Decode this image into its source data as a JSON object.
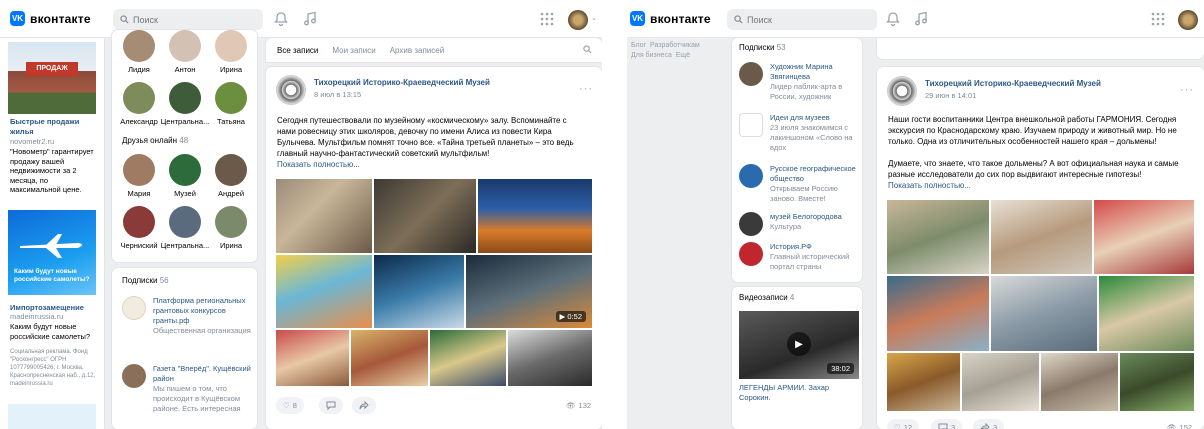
{
  "brand": "вконтакте",
  "search_placeholder": "Поиск",
  "left": {
    "friends_top": [
      "Лидия",
      "Антон",
      "Ирина",
      "Александр",
      "Центральна...",
      "Татьяна"
    ],
    "friends_online_label": "Друзья онлайн",
    "friends_online_count": "48",
    "friends_online": [
      "Мария",
      "Музей",
      "Андрей",
      "Черниский",
      "Центральна...",
      "Ирина"
    ],
    "ads": [
      {
        "title": "Быстрые продажи жилья",
        "source": "novometr2.ru",
        "text": "\"Новометр\" гарантирует продажу вашей недвижимости за 2 месяца, по максимальной цене."
      },
      {
        "title": "Импортозамещение",
        "source": "madeinrussia.ru",
        "text": "Каким будут новые российские самолеты?",
        "legal": "Социальная реклама. Фонд \"Росконгресс\" ОГРН 1077799005426, г. Москва, Краснопресненская наб., д.12, madeinrussia.ru",
        "banner_text": "Каким будут новые российские самолеты?"
      }
    ],
    "subs_label": "Подписки",
    "subs_count": "56",
    "subs": [
      {
        "name": "Платформа региональных грантовых конкурсов гранты.рф",
        "desc": "Общественная организация"
      },
      {
        "name": "Газета \"Вперёд\". Кущёвский район",
        "desc": "Мы пишем о том, что происходит в Кущёвском районе. Есть интересная"
      }
    ],
    "tabs": [
      "Все записи",
      "Мои записи",
      "Архив записей"
    ],
    "post": {
      "author": "Тихорецкий Историко-Краеведческий Музей",
      "date": "8 июл в 13:15",
      "text": "Сегодня путешествовали по музейному «космическому» залу. Вспоминайте с нами ровесницу этих школяров, девочку по имени Алиса из повести Кира Булычева. Мультфильм помнят точно все. «Тайна третьей планеты» – это ведь главный научно-фантастический советский мультфильм!",
      "more": "Показать полностью...",
      "video_duration": "0:52",
      "likes": "8",
      "views": "132"
    }
  },
  "right": {
    "side_links": [
      "Блог",
      "Разработчикам",
      "Для бизнеса",
      "Ещё"
    ],
    "subs_label": "Подписки",
    "subs_count": "53",
    "subs": [
      {
        "name": "Художник Марина Звягинцева",
        "desc": "Лидер паблик-арта в России, художник"
      },
      {
        "name": "Идеи для музеев",
        "desc": "23 июля знакомимся с лакиншоном «Слово на вдох"
      },
      {
        "name": "Русское географическое общество",
        "desc": "Открываем Россию заново. Вместе!"
      },
      {
        "name": "музей Белогородова",
        "desc": "Культура"
      },
      {
        "name": "История.РФ",
        "desc": "Главный исторический портал страны"
      }
    ],
    "videos_label": "Видеозаписи",
    "videos_count": "4",
    "video": {
      "duration": "38:02",
      "title": "ЛЕГЕНДЫ АРМИИ. Захар Сорокин."
    },
    "post": {
      "author": "Тихорецкий Историко-Краеведческий Музей",
      "date": "29 июн в 14:01",
      "text1": "Наши гости воспитанники Центра внешкольной работы ГАРМОНИЯ. Сегодня экскурсия по Краснодарскому краю. Изучаем природу и животный мир. Но не только. Одна из отличительных особенностей нашего края – дольмены!",
      "text2": "Думаете, что знаете, что такое дольмены? А вот официальная наука и самые разные исследователи до сих пор выдвигают интересные гипотезы!",
      "more": "Показать полностью...",
      "likes": "12",
      "comments": "3",
      "reposts": "3",
      "views": "152"
    }
  }
}
